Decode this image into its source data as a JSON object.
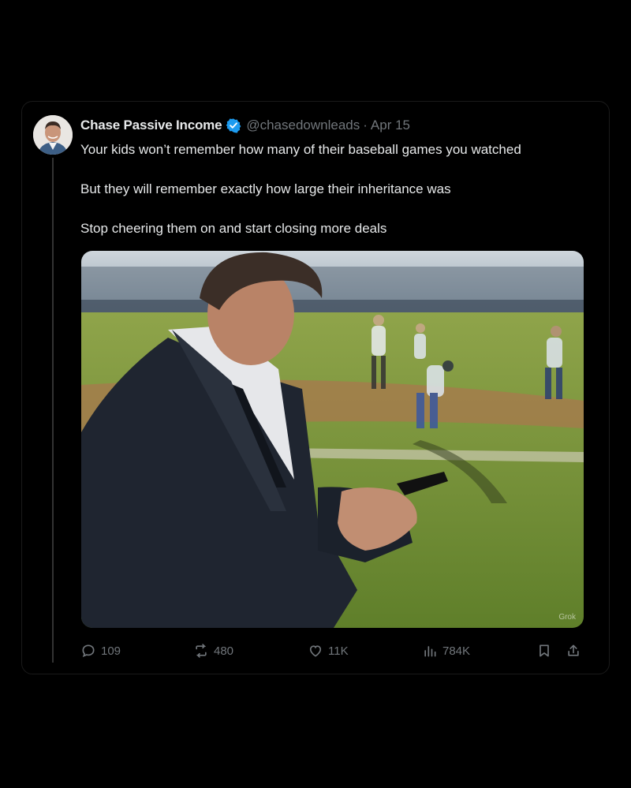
{
  "post": {
    "author_name": "Chase Passive Income",
    "handle": "@chasedownleads",
    "separator": "·",
    "date": "Apr 15",
    "lines": [
      "Your kids won’t remember how many of their baseball games you watched",
      "But they will remember exactly how large their inheritance was",
      "Stop cheering them on and start closing more deals"
    ],
    "media_watermark": "Grok"
  },
  "actions": {
    "replies": "109",
    "reposts": "480",
    "likes": "11K",
    "views": "784K"
  },
  "icons": {
    "verified": "verified-badge-icon",
    "reply": "reply-icon",
    "repost": "repost-icon",
    "like": "heart-icon",
    "views": "views-chart-icon",
    "bookmark": "bookmark-icon",
    "share": "share-icon"
  },
  "colors": {
    "background": "#000000",
    "text": "#e7e9ea",
    "muted": "#71767b",
    "verified": "#1d9bf0"
  }
}
